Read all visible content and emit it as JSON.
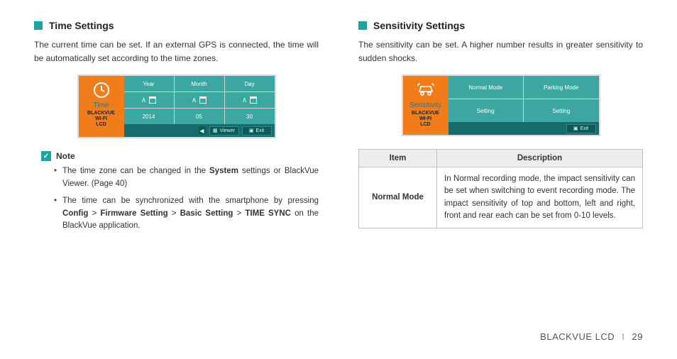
{
  "left": {
    "title": "Time Settings",
    "body": "The current time can be set. If an external GPS is connected, the time will be automatically set according to the time zones.",
    "shot": {
      "side_label": "Time",
      "brand": "BLACKVUE\nWI-FI\nLCD",
      "cols": [
        "Year",
        "Month",
        "Day"
      ],
      "vals": [
        "2014",
        "05",
        "30"
      ],
      "footer_left": "Viewer",
      "footer_right": "Exit"
    },
    "note_label": "Note",
    "notes": [
      {
        "pre": "The time zone can be changed in the ",
        "b1": "System",
        "post": " settings or BlackVue Viewer. (Page 40)"
      },
      {
        "pre": "The time can be synchronized with the smartphone by pressing ",
        "chain": [
          "Config",
          "Firmware Setting",
          "Basic Setting",
          "TIME SYNC"
        ],
        "post": " on the BlackVue application."
      }
    ]
  },
  "right": {
    "title": "Sensitivity Settings",
    "body": "The sensitivity can be set. A higher number results in greater sensitivity to sudden shocks.",
    "shot": {
      "side_label": "Sensitivity",
      "brand": "BLACKVUE\nWI-FI\nLCD",
      "cells": [
        "Normal Mode",
        "Parking Mode",
        "Setting",
        "Setting"
      ],
      "footer_right": "Exit"
    },
    "table": {
      "header_item": "Item",
      "header_desc": "Description",
      "row_item": "Normal Mode",
      "row_desc": "In Normal recording mode, the impact sensitivity can be set when switching to event recording mode. The impact sensitivity of top and bottom, left and right, front and rear each can be set from 0-10 levels."
    }
  },
  "footer": {
    "product": "BLACKVUE LCD",
    "page": "29"
  }
}
